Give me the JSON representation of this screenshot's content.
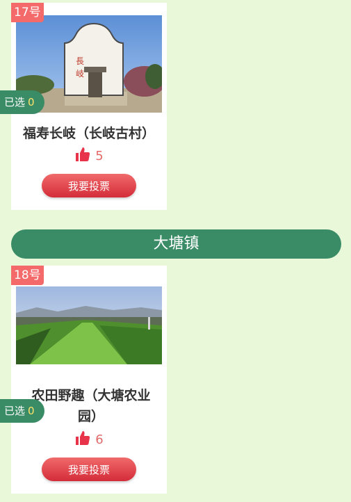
{
  "entries": [
    {
      "number": "17号",
      "title": "福寿长岐（长岐古村）",
      "likes": "5",
      "vote_label": "我要投票",
      "selected_label": "已选",
      "selected_count": "0"
    },
    {
      "number": "18号",
      "title": "农田野趣（大塘农业园）",
      "likes": "6",
      "vote_label": "我要投票",
      "selected_label": "已选",
      "selected_count": "0"
    }
  ],
  "section": {
    "title": "大塘镇"
  },
  "colors": {
    "background": "#e8f8d8",
    "accent_green": "#3a8c66",
    "tag_red": "#f46a6a",
    "like_red": "#e8344a",
    "vote_button": "#d42c3a"
  },
  "icons": {
    "like": "thumbs-up-icon"
  }
}
